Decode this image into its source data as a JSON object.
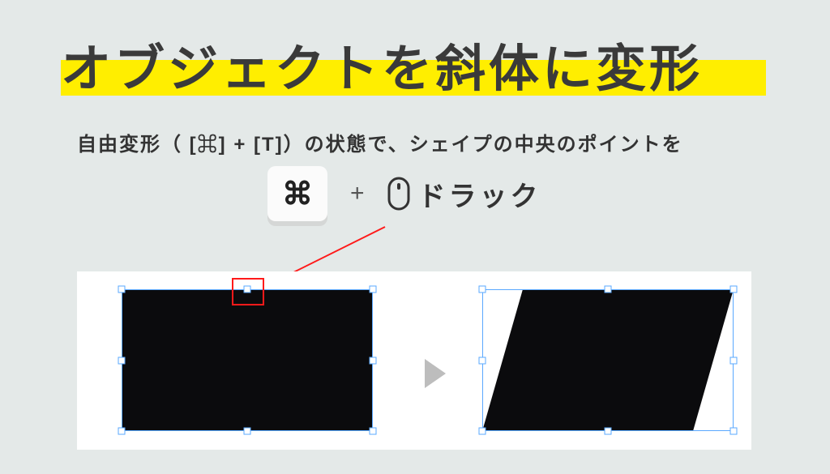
{
  "title": "オブジェクトを斜体に変形",
  "subtitle_parts": {
    "s1": "自由変形（ [⌘] + [T]）の状態で、シェイプの中央のポイントを"
  },
  "shortcut": {
    "key_label": "⌘",
    "plus": "+",
    "drag_label": "ドラック"
  },
  "colors": {
    "highlight": "#ffee00",
    "red": "#ff1a1a",
    "selection": "#5aa8ff",
    "shape": "#0b0b0d",
    "arrow": "#bdbdbd"
  }
}
